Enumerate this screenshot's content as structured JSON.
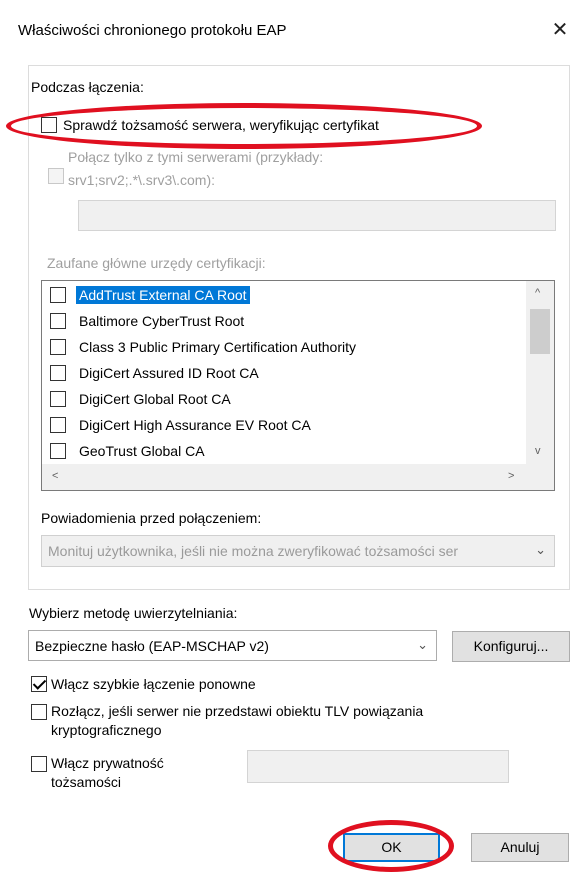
{
  "window": {
    "title": "Właściwości chronionego protokołu EAP",
    "close_glyph": "✕"
  },
  "connect_section": {
    "heading": "Podczas łączenia:",
    "verify_cert_label": "Sprawdź tożsamość serwera, weryfikując certyfikat",
    "verify_cert_checked": false,
    "connect_servers_label_line1": "Połącz tylko z tymi serwerami (przykłady:",
    "connect_servers_label_line2": "srv1;srv2;.*\\.srv3\\.com):",
    "connect_servers_value": "",
    "trusted_ca_heading": "Zaufane główne urzędy certyfikacji:",
    "trusted_ca_list": [
      {
        "label": "AddTrust External CA Root",
        "checked": false,
        "selected": true
      },
      {
        "label": "Baltimore CyberTrust Root",
        "checked": false,
        "selected": false
      },
      {
        "label": "Class 3 Public Primary Certification Authority",
        "checked": false,
        "selected": false
      },
      {
        "label": "DigiCert Assured ID Root CA",
        "checked": false,
        "selected": false
      },
      {
        "label": "DigiCert Global Root CA",
        "checked": false,
        "selected": false
      },
      {
        "label": "DigiCert High Assurance EV Root CA",
        "checked": false,
        "selected": false
      },
      {
        "label": "GeoTrust Global CA",
        "checked": false,
        "selected": false
      }
    ],
    "scroll_up_glyph": "^",
    "scroll_down_glyph": "v",
    "scroll_left_glyph": "<",
    "scroll_right_glyph": ">",
    "notifications_heading": "Powiadomienia przed połączeniem:",
    "notifications_value": "Monituj użytkownika, jeśli nie można zweryfikować tożsamości ser"
  },
  "auth_section": {
    "heading": "Wybierz metodę uwierzytelniania:",
    "method_value": "Bezpieczne hasło (EAP-MSCHAP v2)",
    "configure_label": "Konfiguruj...",
    "fast_reconnect_label": "Włącz szybkie łączenie ponowne",
    "fast_reconnect_checked": true,
    "disconnect_tlv_label_line1": "Rozłącz, jeśli serwer nie przedstawi obiektu TLV powiązania",
    "disconnect_tlv_label_line2": "kryptograficznego",
    "disconnect_tlv_checked": false,
    "identity_privacy_label_line1": "Włącz prywatność",
    "identity_privacy_label_line2": "tożsamości",
    "identity_privacy_checked": false,
    "identity_privacy_value": ""
  },
  "footer": {
    "ok_label": "OK",
    "cancel_label": "Anuluj"
  },
  "annotation_color": "#e01020",
  "accent_color": "#0078d7"
}
